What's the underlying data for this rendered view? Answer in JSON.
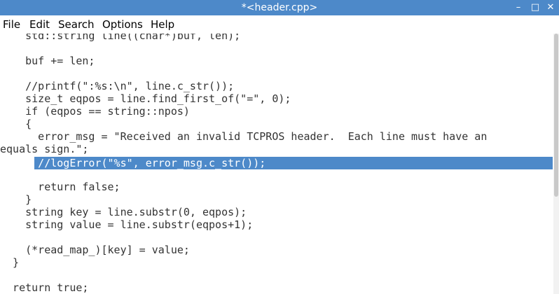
{
  "window": {
    "title": "*<header.cpp>",
    "controls": {
      "minimize": "–",
      "maximize": "□",
      "close": "✕"
    }
  },
  "menu": {
    "file": "File",
    "edit": "Edit",
    "search": "Search",
    "options": "Options",
    "help": "Help"
  },
  "editor": {
    "lines": [
      "    std::string line((char*)buf, len);",
      "",
      "    buf += len;",
      "",
      "    //printf(\":%s:\\n\", line.c_str());",
      "    size_t eqpos = line.find_first_of(\"=\", 0);",
      "    if (eqpos == string::npos)",
      "    {",
      "      error_msg = \"Received an invalid TCPROS header.  Each line must have an",
      "equals sign.\";",
      "      //logError(\"%s\", error_msg.c_str());",
      "",
      "      return false;",
      "    }",
      "    string key = line.substr(0, eqpos);",
      "    string value = line.substr(eqpos+1);",
      "",
      "    (*read_map_)[key] = value;",
      "  }",
      "",
      "  return true;"
    ],
    "selected_line_index": 10
  },
  "colors": {
    "titlebar": "#4d89c9",
    "selection": "#4d89c9",
    "code_text": "#333333"
  }
}
